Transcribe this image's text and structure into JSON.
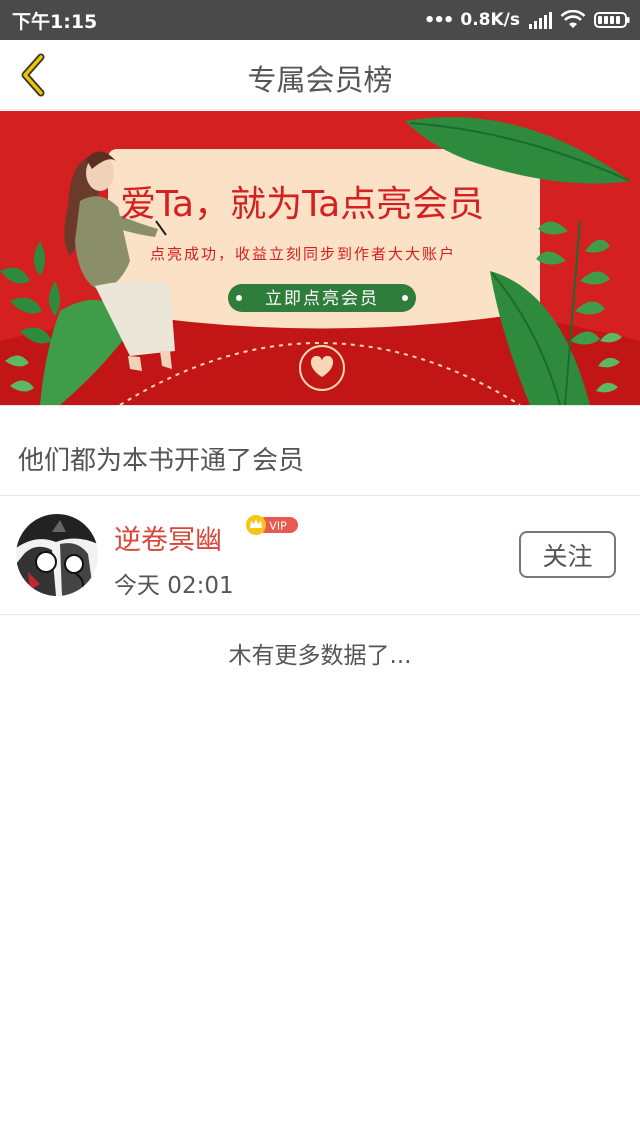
{
  "status_bar": {
    "time": "下午1:15",
    "speed": "0.8K/s",
    "icons": [
      "signal-icon",
      "wifi-icon",
      "battery-icon"
    ]
  },
  "header": {
    "title": "专属会员榜",
    "back_icon": "chevron-left-icon",
    "accent": "#f2c200"
  },
  "banner": {
    "headline": "爱Ta，就为Ta点亮会员",
    "subline": "点亮成功，收益立刻同步到作者大大账户",
    "cta": "立即点亮会员",
    "colors": {
      "red": "#d42020",
      "card": "#fbe2c6",
      "green": "#2e8b3e"
    }
  },
  "section": {
    "title": "他们都为本书开通了会员"
  },
  "members": [
    {
      "name": "逆卷冥幽",
      "badge": "VIP",
      "time": "今天 02:01",
      "follow_label": "关注"
    }
  ],
  "footer": {
    "no_more": "木有更多数据了..."
  }
}
